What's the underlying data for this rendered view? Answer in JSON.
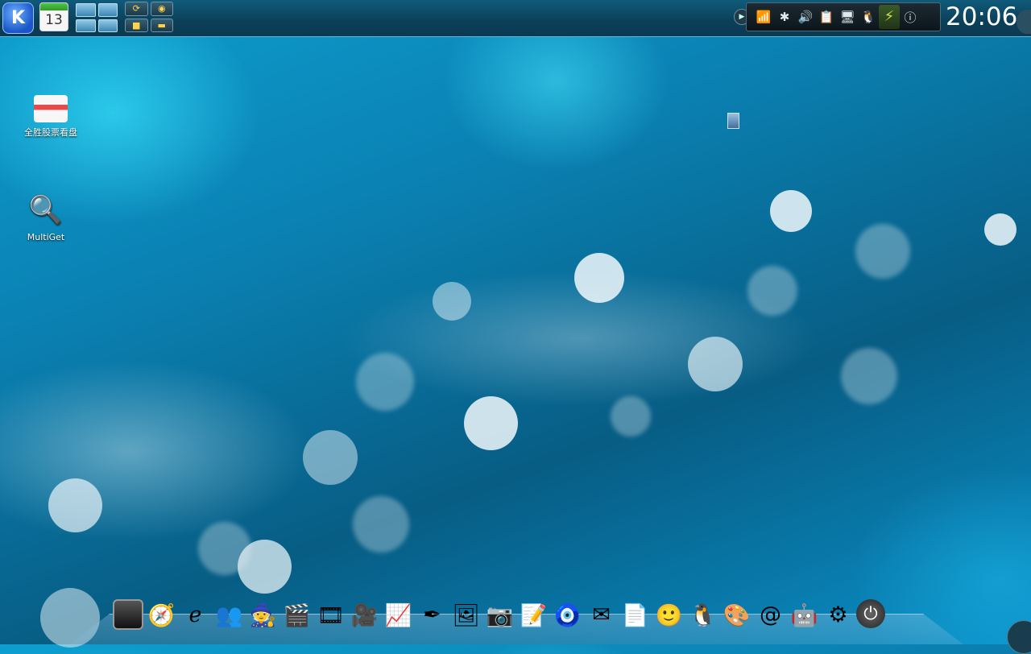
{
  "panel": {
    "kmenu_label": "K",
    "calendar_day": "13",
    "tray_arrow": "▶",
    "tray_icons": [
      "network-icon",
      "bluetooth-icon",
      "volume-icon",
      "clipboard-icon",
      "display-icon",
      "qq-icon",
      "power-manager-icon",
      "info-icon"
    ],
    "tray_glyphs": [
      "📶",
      "✱",
      "🔊",
      "📋",
      "🖥",
      "🐧",
      "⚡",
      "ⓘ"
    ],
    "clock": "20:06"
  },
  "desktop": {
    "icons": [
      {
        "label": "全胜股票看盘",
        "glyph": "",
        "name": "stock-viewer-icon"
      },
      {
        "label": "MultiGet",
        "glyph": "🔍",
        "name": "multiget-icon"
      }
    ]
  },
  "dock": {
    "items": [
      {
        "name": "terminal-icon",
        "glyph": ""
      },
      {
        "name": "safari-icon",
        "glyph": "🧭"
      },
      {
        "name": "internet-explorer-icon",
        "glyph": "ℯ"
      },
      {
        "name": "messenger-icon",
        "glyph": "👥"
      },
      {
        "name": "wizard-icon",
        "glyph": "🧙"
      },
      {
        "name": "video-editor-icon",
        "glyph": "🎬"
      },
      {
        "name": "media-player-icon",
        "glyph": "🎞"
      },
      {
        "name": "film-icon",
        "glyph": "🎥"
      },
      {
        "name": "system-monitor-icon",
        "glyph": "📈"
      },
      {
        "name": "text-editor-icon",
        "glyph": "✒"
      },
      {
        "name": "photo-viewer-icon",
        "glyph": "🖼"
      },
      {
        "name": "camera-icon",
        "glyph": "📷"
      },
      {
        "name": "notes-icon",
        "glyph": "📝"
      },
      {
        "name": "compass-icon",
        "glyph": "🧿"
      },
      {
        "name": "mail-icon",
        "glyph": "✉"
      },
      {
        "name": "document-icon",
        "glyph": "📄"
      },
      {
        "name": "finder-icon",
        "glyph": "🙂"
      },
      {
        "name": "qq-penguin-icon",
        "glyph": "🐧"
      },
      {
        "name": "photo-booth-icon",
        "glyph": "🎨"
      },
      {
        "name": "address-book-icon",
        "glyph": "@"
      },
      {
        "name": "automator-icon",
        "glyph": "🤖"
      },
      {
        "name": "system-preferences-icon",
        "glyph": "⚙"
      },
      {
        "name": "power-icon",
        "glyph": "⏻"
      }
    ]
  }
}
